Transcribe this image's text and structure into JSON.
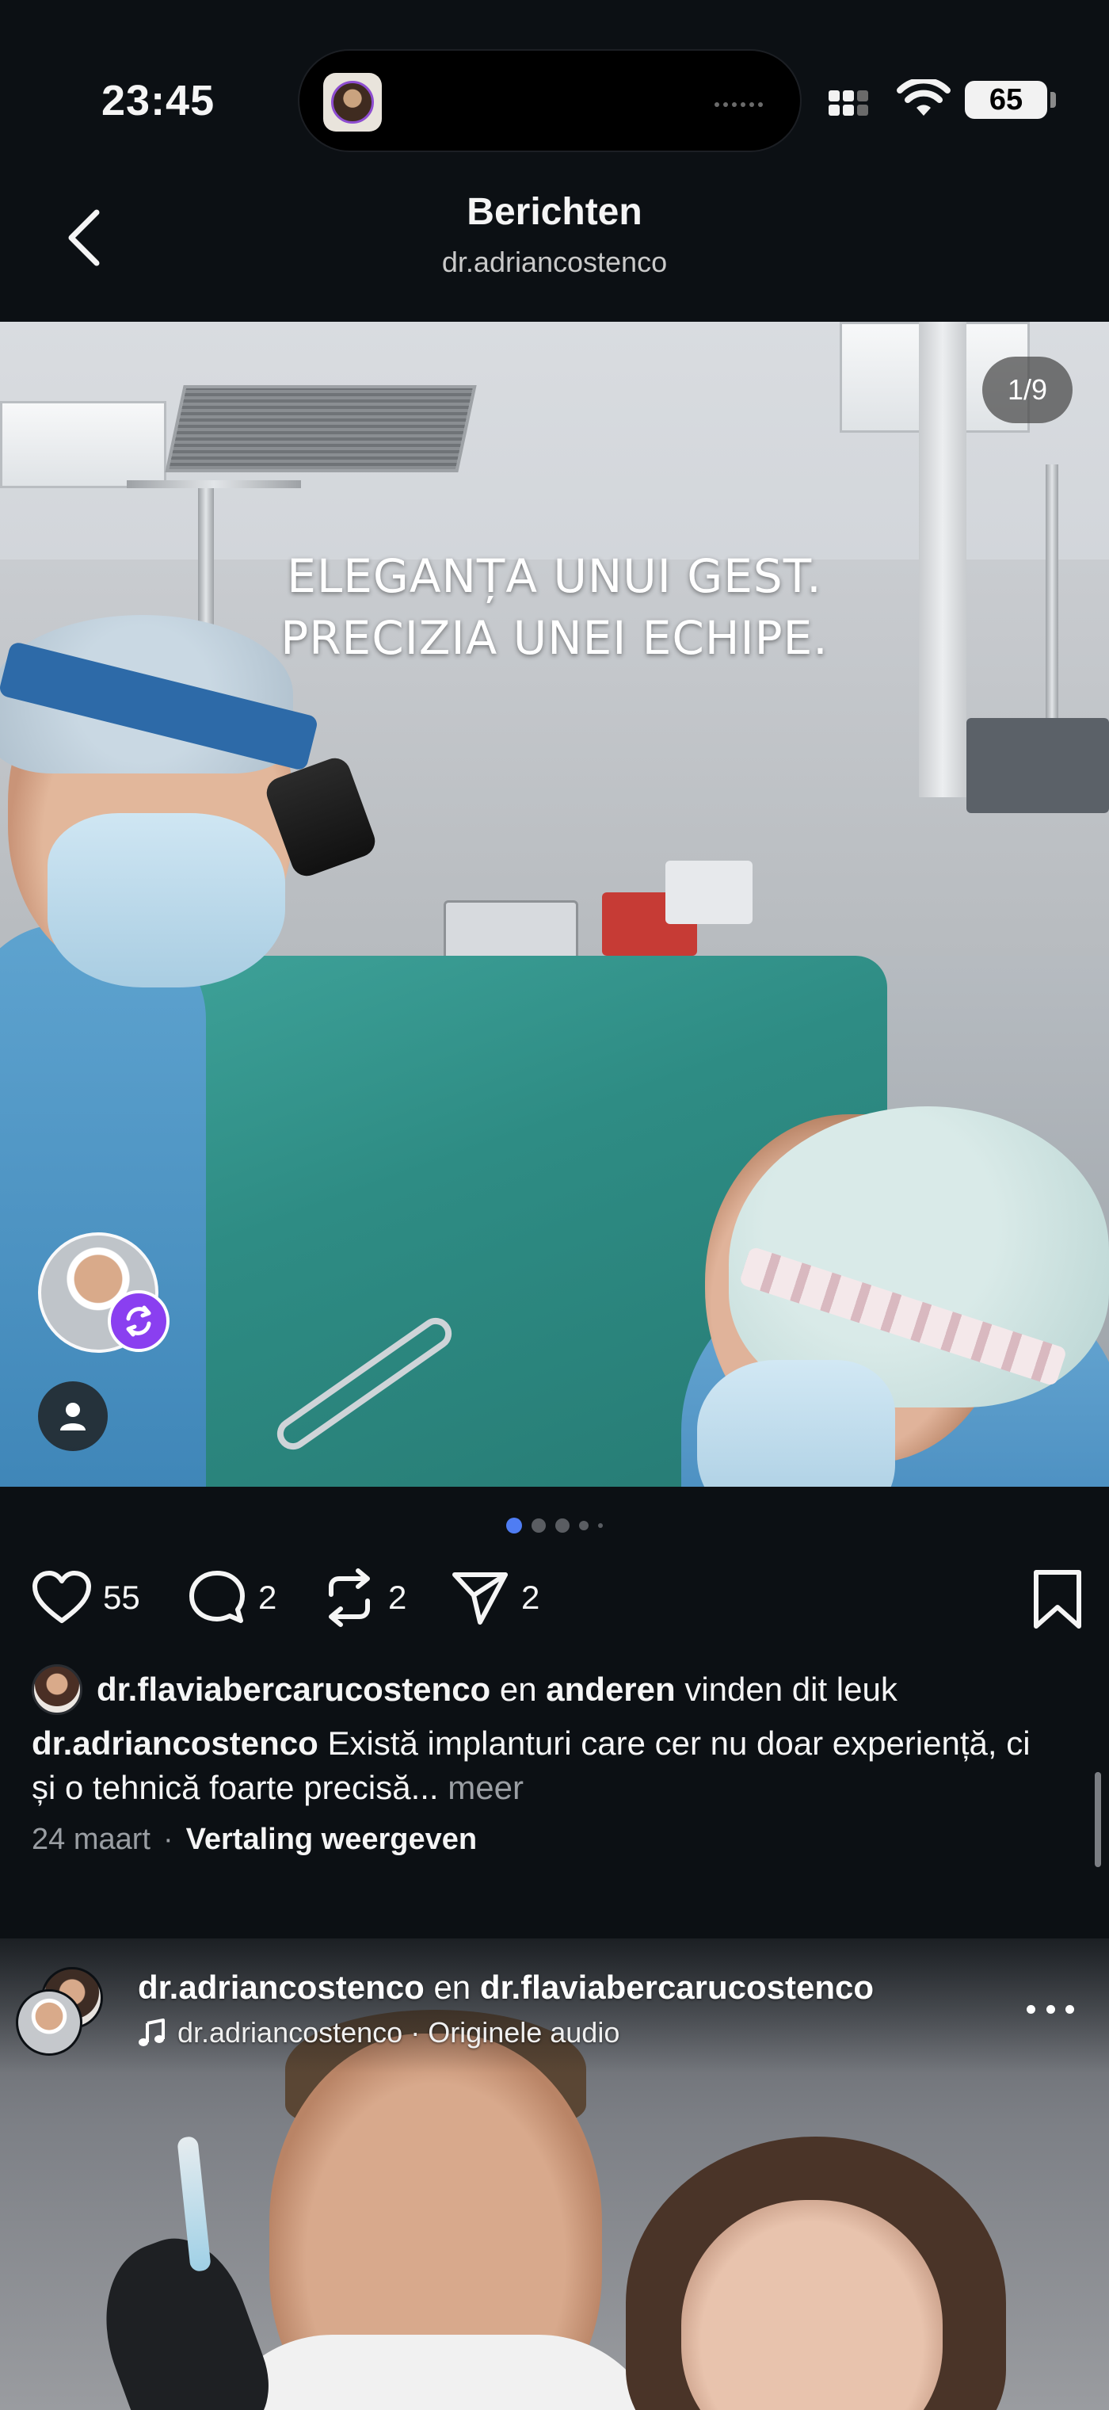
{
  "status_bar": {
    "time": "23:45",
    "battery": "65",
    "icons": [
      "signal-icon",
      "wifi-icon",
      "battery-icon"
    ]
  },
  "header": {
    "title": "Berichten",
    "subtitle": "dr.adriancostenco",
    "back_icon": "chevron-left-icon"
  },
  "post": {
    "overlay_line1": "ELEGANȚA UNUI GEST.",
    "overlay_line2": "PRECIZIA UNEI ECHIPE.",
    "counter": "1/9",
    "pager": {
      "total_visible": 5,
      "active_index": 0,
      "active_color": "#4f7df3"
    },
    "actions": {
      "likes": "55",
      "comments": "2",
      "reposts": "2",
      "shares": "2"
    },
    "liked_by": {
      "user": "dr.flaviabercarucostenco",
      "connector": "en",
      "others": "anderen",
      "suffix": "vinden dit leuk"
    },
    "caption": {
      "author": "dr.adriancostenco",
      "text": "Există implanturi care cer nu doar experiență, ci și o tehnică foarte precisă...",
      "more": "meer"
    },
    "date": "24 maart",
    "separator": "·",
    "translate": "Vertaling weergeven"
  },
  "next_post": {
    "author1": "dr.adriancostenco",
    "connector": "en",
    "author2": "dr.flaviabercarucostenco",
    "audio_author": "dr.adriancostenco",
    "audio_sep": "·",
    "audio_label": "Originele audio"
  },
  "colors": {
    "background": "#0c1014",
    "text": "#f5f5f5",
    "muted": "#9a9ea3",
    "repost_badge": "#8a3ff0",
    "pager_active": "#4f7df3"
  }
}
